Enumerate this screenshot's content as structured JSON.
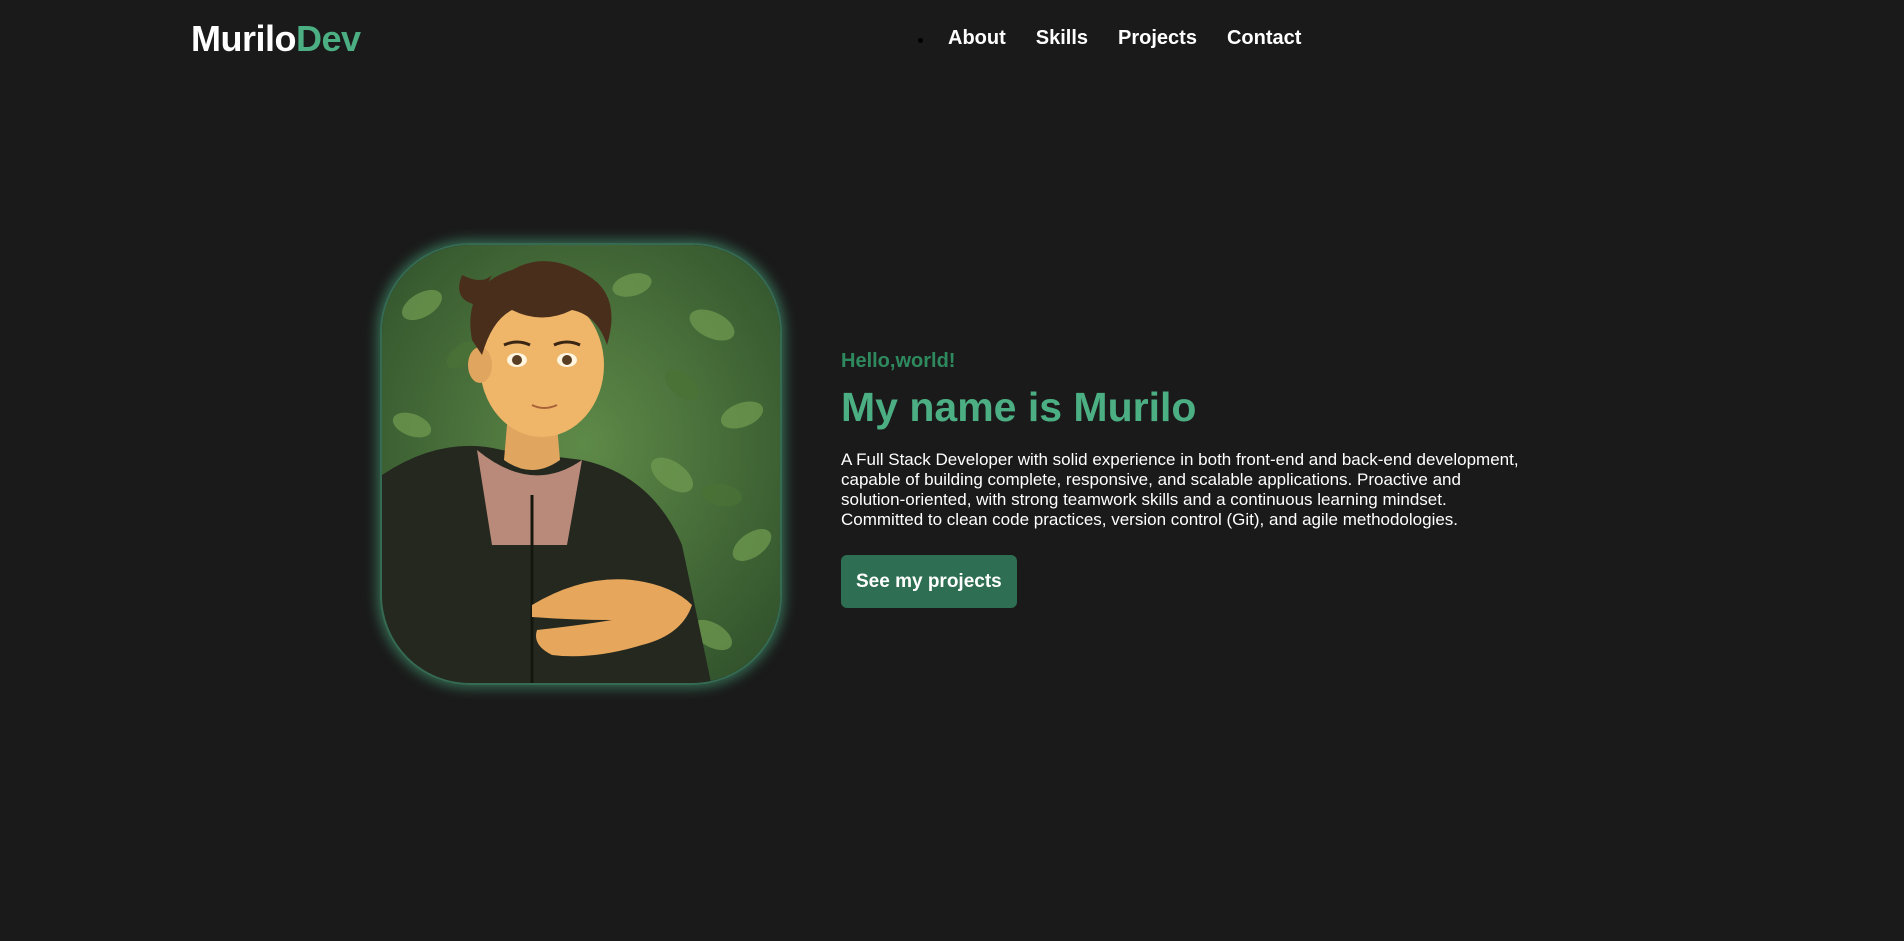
{
  "header": {
    "logo_main": "Murilo",
    "logo_accent": "Dev",
    "nav": [
      "About",
      "Skills",
      "Projects",
      "Contact"
    ]
  },
  "hero": {
    "greeting": "Hello,world!",
    "title": "My name is Murilo",
    "description": "A Full Stack Developer with solid experience in both front-end and back-end development, capable of building complete, responsive, and scalable applications. Proactive and solution-oriented, with strong teamwork skills and a continuous learning mindset. Committed to clean code practices, version control (Git), and agile methodologies.",
    "cta_label": "See my projects",
    "portrait_alt": "Illustrated portrait of Murilo"
  },
  "colors": {
    "background": "#1a1a1a",
    "accent": "#4caf84",
    "accent_dark": "#2e8a5e",
    "button": "#2e6e52"
  }
}
